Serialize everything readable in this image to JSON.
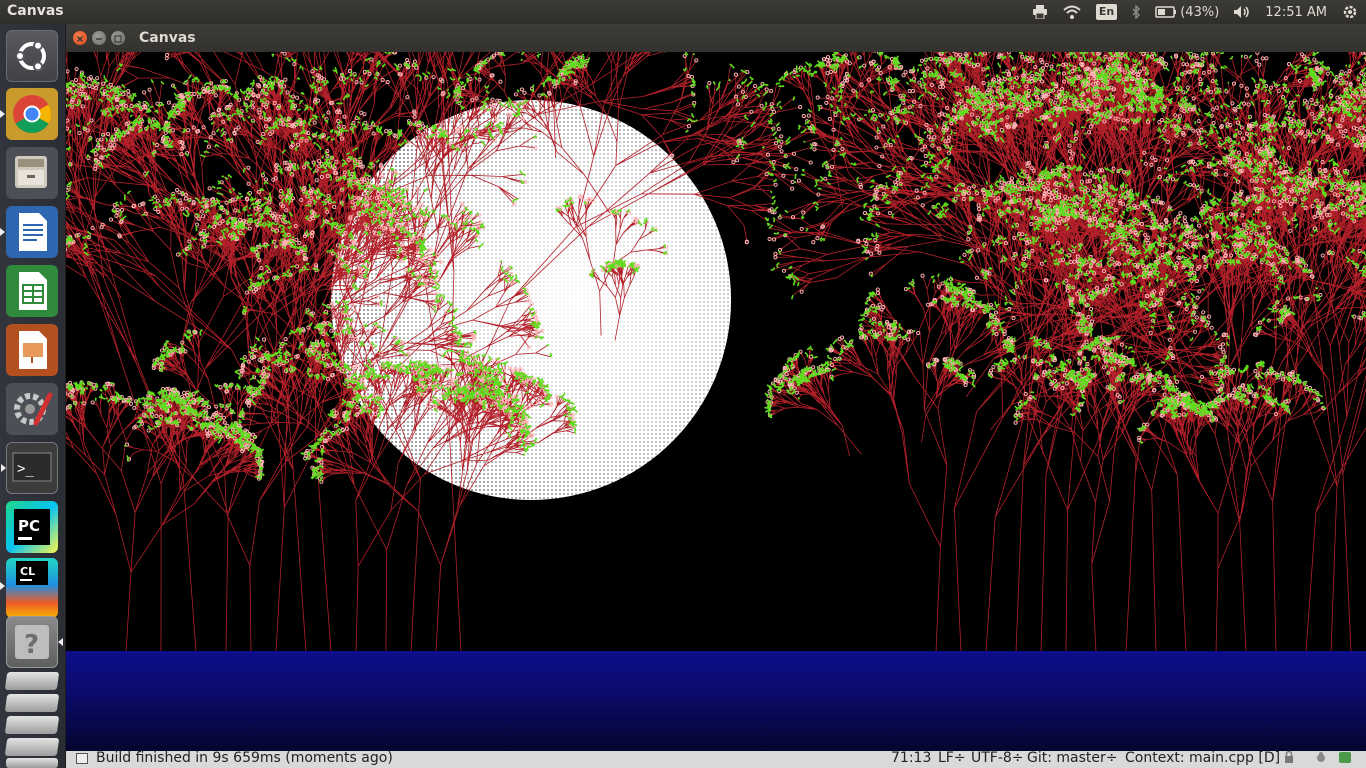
{
  "top_panel": {
    "app_title": "Canvas",
    "keyboard_layout": "En",
    "battery_text": "(43%)",
    "clock": "12:51 AM"
  },
  "launcher": {
    "items": [
      {
        "name": "ubuntu-dash",
        "icon": "ubuntu-logo-icon"
      },
      {
        "name": "chrome",
        "icon": "chrome-icon"
      },
      {
        "name": "files",
        "icon": "file-cabinet-icon"
      },
      {
        "name": "libreoffice-writer",
        "icon": "writer-icon"
      },
      {
        "name": "libreoffice-calc",
        "icon": "calc-icon"
      },
      {
        "name": "libreoffice-impress",
        "icon": "impress-icon"
      },
      {
        "name": "system-settings",
        "icon": "settings-wrench-icon"
      },
      {
        "name": "terminal",
        "icon": "terminal-icon",
        "label": ">_"
      },
      {
        "name": "pycharm",
        "icon": "pycharm-icon",
        "label": "PC"
      },
      {
        "name": "clion",
        "icon": "clion-icon",
        "label": "CL"
      },
      {
        "name": "unknown-app",
        "icon": "question-icon",
        "label": "?"
      }
    ],
    "colors": {
      "chrome_red": "#db4437",
      "chrome_green": "#0f9d58",
      "chrome_yellow": "#f4b400",
      "chrome_blue": "#4285f4",
      "ubuntu_orange": "#e95420"
    }
  },
  "window": {
    "title": "Canvas",
    "buttons": {
      "close": "#e95420",
      "minimize": "#8a8983",
      "maximize": "#8a8983"
    }
  },
  "canvas": {
    "moon_color": "#ffffff",
    "sky_color": "#000000",
    "leaf_color": "#5fdc1e",
    "branch_color": "#b3202a",
    "blossom_color": "#ffb6b6",
    "water_color": "#0d0e8a"
  },
  "status_bar": {
    "build_message": "Build finished in 9s 659ms (moments ago)",
    "cursor_position": "71:13",
    "line_ending": "LF÷",
    "encoding": "UTF-8÷",
    "git_branch": "Git: master÷",
    "context": "Context: main.cpp [D]"
  }
}
